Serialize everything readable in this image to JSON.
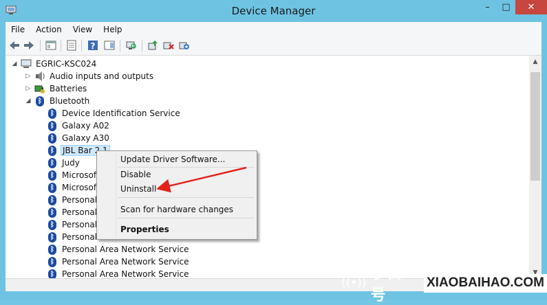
{
  "window": {
    "title": "Device Manager",
    "controls": {
      "minimize": "–",
      "maximize": "□",
      "close": "✕"
    }
  },
  "menu": [
    "File",
    "Action",
    "View",
    "Help"
  ],
  "toolbar_icons": [
    "back-arrow-icon",
    "forward-arrow-icon",
    "show-hide-console-tree-icon",
    "properties-icon",
    "help-icon",
    "action-pane-icon",
    "computer-scan-icon",
    "update-driver-icon",
    "uninstall-device-icon",
    "scan-hardware-icon"
  ],
  "tree": {
    "root": "EGRIC-KSC024",
    "categories": [
      {
        "label": "Audio inputs and outputs",
        "icon": "speaker-icon",
        "expanded": false
      },
      {
        "label": "Batteries",
        "icon": "battery-icon",
        "expanded": false
      },
      {
        "label": "Bluetooth",
        "icon": "bluetooth-icon",
        "expanded": true
      }
    ],
    "bluetooth_devices": [
      "Device Identification Service",
      "Galaxy A02",
      "Galaxy A30",
      "JBL Bar 2.1",
      "Judy",
      "Microsoft Bluetooth Enumerator",
      "Microsoft Bluetooth LE Enumerator",
      "Personal Area Network Service",
      "Personal Area Network Service",
      "Personal Area Network Service",
      "Personal Area Network Service",
      "Personal Area Network Service",
      "Personal Area Network Service",
      "Personal Area Network Service"
    ],
    "selected_device": "JBL Bar 2.1"
  },
  "context_menu": {
    "items": [
      {
        "label": "Update Driver Software...",
        "bold": false
      },
      {
        "label": "Disable",
        "bold": false
      },
      {
        "label": "Uninstall",
        "bold": false
      },
      {
        "label": "Scan for hardware changes",
        "bold": false
      },
      {
        "label": "Properties",
        "bold": true
      }
    ]
  },
  "annotation": {
    "arrow_color": "#e2231a",
    "points_to": "Uninstall"
  },
  "watermark": {
    "symbol": "((•))",
    "cn": "小白号",
    "en": "XIAOBAIHAO.COM"
  },
  "colors": {
    "titlebar": "#6ec3e3",
    "close_button": "#c7463e",
    "selection": "#cde8ff",
    "bluetooth_icon": "#1b4aa0"
  }
}
